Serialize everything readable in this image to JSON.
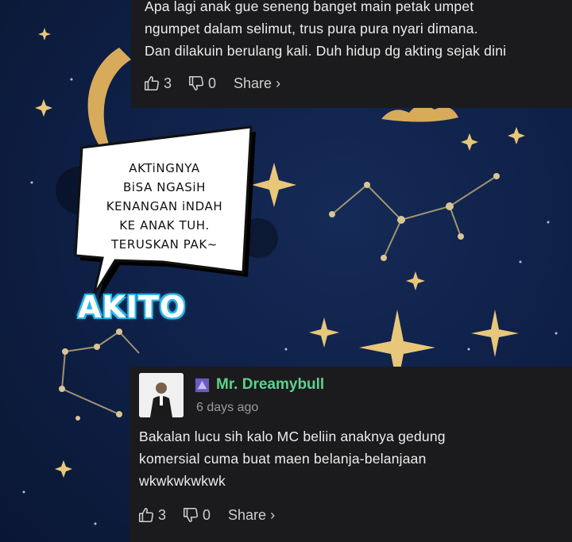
{
  "top_comment": {
    "lines": [
      "Apa lagi anak gue seneng banget main petak umpet",
      "ngumpet dalam selimut, trus pura pura nyari dimana.",
      "Dan dilakuin berulang kali. Duh hidup dg akting sejak dini"
    ],
    "likes": "3",
    "dislikes": "0",
    "share_label": "Share ›"
  },
  "overlay": {
    "bubble_lines": [
      "AKTiNGNYA",
      "BiSA NGASiH",
      "KENANGAN iNDAH",
      "KE ANAK TUH.",
      "TERUSKAN PAK~"
    ],
    "signature": "AKITO"
  },
  "bottom_comment": {
    "username": "Mr. Dreamybull",
    "timestamp": "6 days ago",
    "lines": [
      "Bakalan lucu sih kalo MC beliin anaknya gedung",
      "komersial cuma buat maen belanja-belanjaan",
      "wkwkwkwkwk"
    ],
    "likes": "3",
    "dislikes": "0",
    "share_label": "Share ›"
  },
  "colors": {
    "card_bg": "#1b1b1d",
    "username": "#5fd08f",
    "gold": "#d7ab5a",
    "sky": "#0e1f45",
    "akito_glow": "#2fb6e8"
  }
}
